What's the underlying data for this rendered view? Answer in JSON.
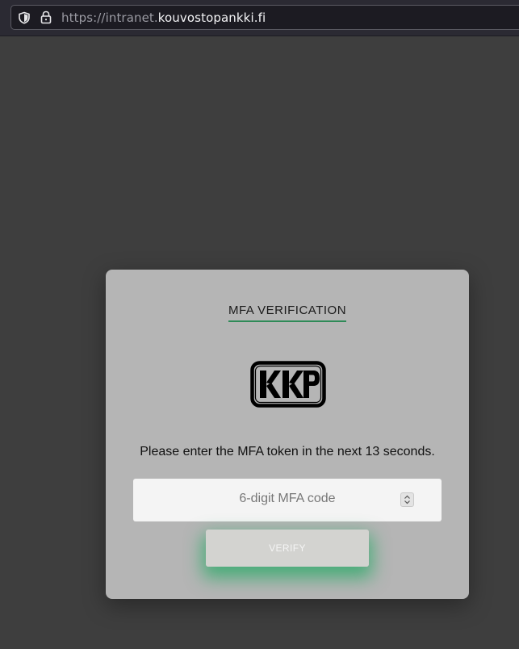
{
  "browser": {
    "url_prefix": "https://intranet.",
    "url_domain": "kouvostopankki.fi"
  },
  "modal": {
    "title": "MFA VERIFICATION",
    "logo_text": "KKP",
    "prompt": "Please enter the MFA token in the next 13 seconds.",
    "input_placeholder": "6-digit MFA code",
    "verify_label": "VERIFY"
  },
  "colors": {
    "accent": "#2e8a57",
    "glow": "#24aa64",
    "modal_bg": "#b5b5b5",
    "page_bg": "#3e3e3e"
  },
  "icons": {
    "shield": "shield-icon",
    "lock": "lock-icon",
    "spinner": "number-spinner-icon"
  }
}
